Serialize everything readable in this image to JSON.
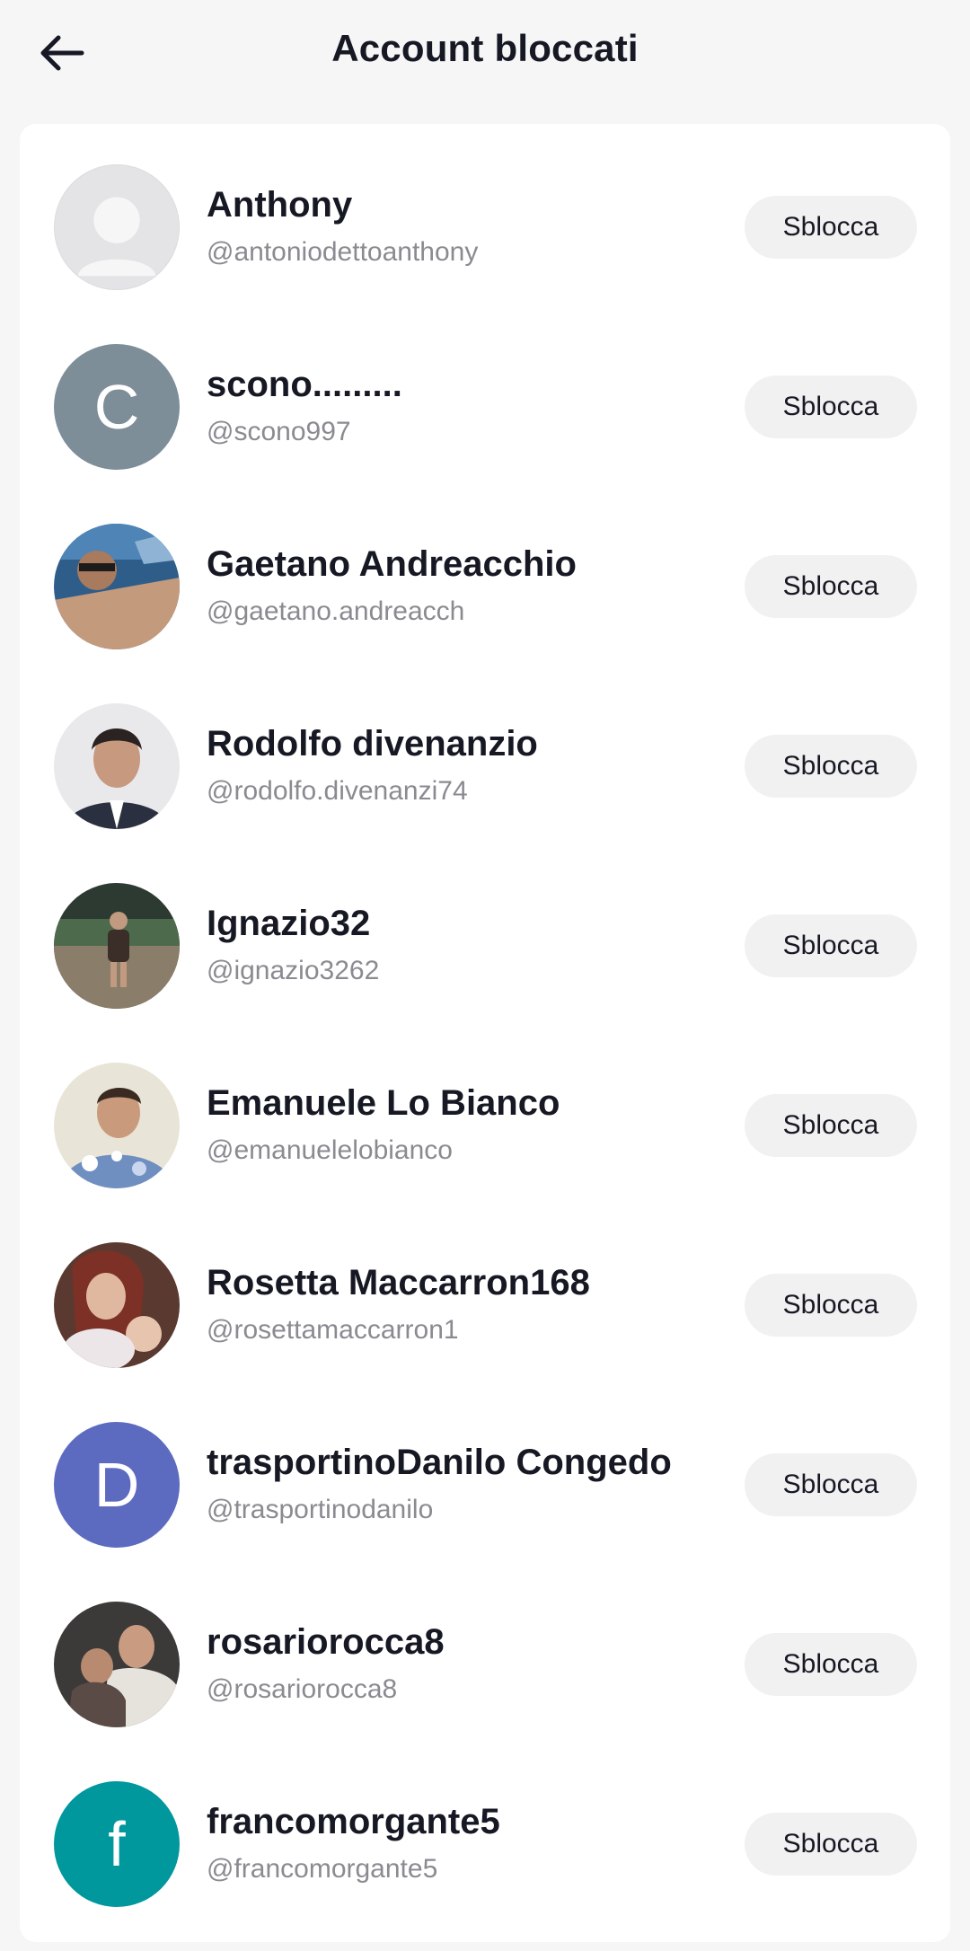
{
  "header": {
    "title": "Account bloccati",
    "back_icon": "arrow-left-icon"
  },
  "accounts": [
    {
      "name": "Anthony",
      "handle": "@antoniodettoanthony",
      "button": "Sblocca",
      "avatar_type": "default-person",
      "avatar_color": "#e4e4e6"
    },
    {
      "name": "scono.........",
      "handle": "@scono997",
      "button": "Sblocca",
      "avatar_type": "letter",
      "avatar_letter": "C",
      "avatar_color": "#7d8e99"
    },
    {
      "name": "Gaetano Andreacchio",
      "handle": "@gaetano.andreacch",
      "button": "Sblocca",
      "avatar_type": "photo",
      "avatar_color": "#8a6a55"
    },
    {
      "name": "Rodolfo divenanzio",
      "handle": "@rodolfo.divenanzi74",
      "button": "Sblocca",
      "avatar_type": "photo",
      "avatar_color": "#3b3f4a"
    },
    {
      "name": "Ignazio32",
      "handle": "@ignazio3262",
      "button": "Sblocca",
      "avatar_type": "photo",
      "avatar_color": "#4f5a52"
    },
    {
      "name": "Emanuele Lo Bianco",
      "handle": "@emanuelelobianco",
      "button": "Sblocca",
      "avatar_type": "photo",
      "avatar_color": "#7b93b8"
    },
    {
      "name": "Rosetta Maccarron168",
      "handle": "@rosettamaccarron1",
      "button": "Sblocca",
      "avatar_type": "photo",
      "avatar_color": "#7a4b3e"
    },
    {
      "name": "trasportinoDanilo Congedo",
      "handle": "@trasportinodanilo",
      "button": "Sblocca",
      "avatar_type": "letter",
      "avatar_letter": "D",
      "avatar_color": "#5c6bc0"
    },
    {
      "name": "rosariorocca8",
      "handle": "@rosariorocca8",
      "button": "Sblocca",
      "avatar_type": "photo",
      "avatar_color": "#6d5a52"
    },
    {
      "name": "francomorgante5",
      "handle": "@francomorgante5",
      "button": "Sblocca",
      "avatar_type": "letter",
      "avatar_letter": "f",
      "avatar_color": "#00979d"
    }
  ]
}
